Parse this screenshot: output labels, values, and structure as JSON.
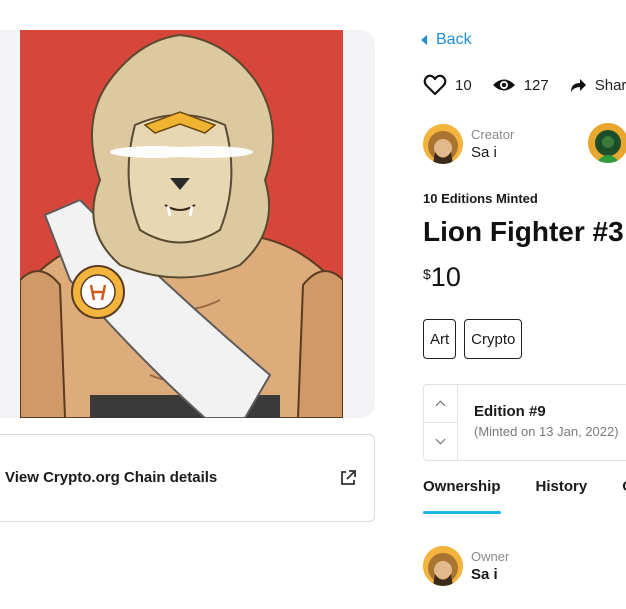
{
  "nav": {
    "back_label": "Back"
  },
  "stats": {
    "likes": "10",
    "views": "127",
    "share_label": "Share"
  },
  "creator": {
    "role": "Creator",
    "name": "Sa i"
  },
  "nft": {
    "editions_minted": "10 Editions Minted",
    "title": "Lion Fighter #3",
    "currency_symbol": "$",
    "price": "10",
    "tags": [
      "Art",
      "Crypto"
    ]
  },
  "edition": {
    "label": "Edition #9",
    "minted": "(Minted on 13 Jan, 2022)"
  },
  "chain": {
    "details_label": "View Crypto.org Chain details"
  },
  "tabs": [
    {
      "label": "Ownership",
      "active": true
    },
    {
      "label": "History",
      "active": false
    },
    {
      "label": "O",
      "active": false
    }
  ],
  "owner": {
    "role": "Owner",
    "name": "Sa i"
  },
  "colors": {
    "accent": "#1f8ed8",
    "tab_underline": "#1fb4e8",
    "art_background": "#d7463a"
  },
  "icons": {
    "like": "heart-icon",
    "views": "eye-icon",
    "share": "share-arrow-icon",
    "back": "caret-left-icon",
    "external": "external-link-icon"
  }
}
